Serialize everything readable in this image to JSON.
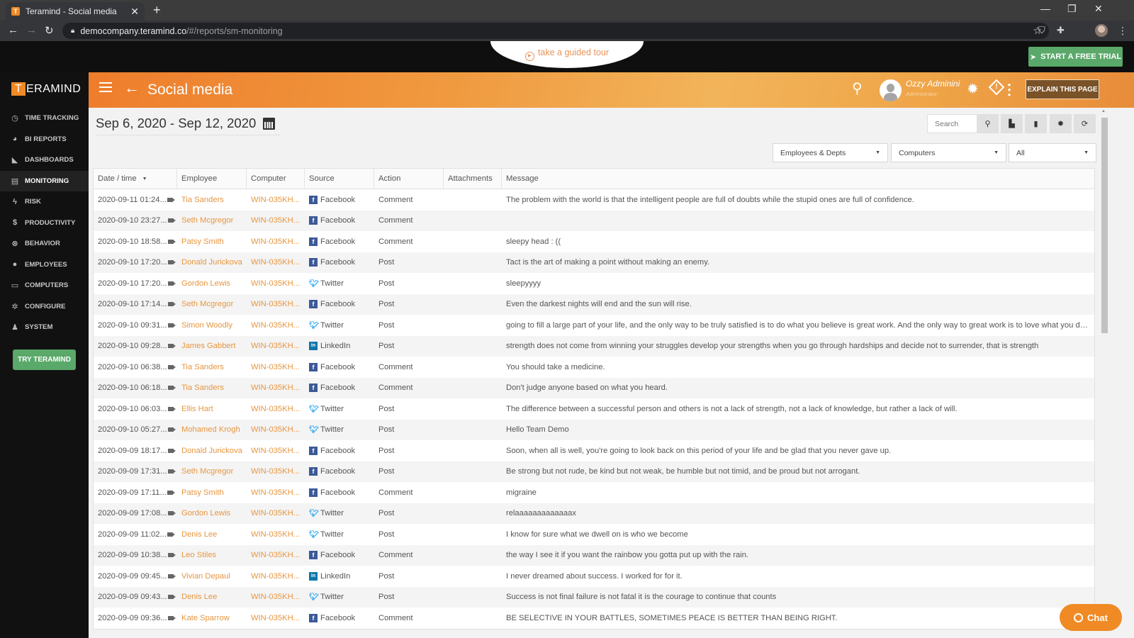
{
  "browser": {
    "tab_title": "Teramind - Social media",
    "favicon_letter": "T",
    "url_host": "democompany.teramind.co",
    "url_path": "/#/reports/sm-monitoring"
  },
  "topbar": {
    "tour_label": "take a guided tour",
    "trial_button": "START A FREE TRIAL"
  },
  "sidebar": {
    "logo_letter": "T",
    "logo_rest": "ERAMIND",
    "items": [
      {
        "label": "TIME TRACKING",
        "icon": "clock-icon",
        "glyph": "◷",
        "active": false
      },
      {
        "label": "BI REPORTS",
        "icon": "pie-chart-icon",
        "glyph": "◕",
        "active": false
      },
      {
        "label": "DASHBOARDS",
        "icon": "area-chart-icon",
        "glyph": "◣",
        "active": false
      },
      {
        "label": "MONITORING",
        "icon": "monitoring-icon",
        "glyph": "▤",
        "active": true
      },
      {
        "label": "RISK",
        "icon": "bolt-icon",
        "glyph": "ϟ",
        "active": false
      },
      {
        "label": "PRODUCTIVITY",
        "icon": "dollar-icon",
        "glyph": "$",
        "active": false
      },
      {
        "label": "BEHAVIOR",
        "icon": "gamepad-icon",
        "glyph": "⊗",
        "active": false
      },
      {
        "label": "EMPLOYEES",
        "icon": "users-icon",
        "glyph": "●",
        "active": false
      },
      {
        "label": "COMPUTERS",
        "icon": "desktop-icon",
        "glyph": "▭",
        "active": false
      },
      {
        "label": "CONFIGURE",
        "icon": "gear-icon",
        "glyph": "✲",
        "active": false
      },
      {
        "label": "SYSTEM",
        "icon": "user-search-icon",
        "glyph": "♟",
        "active": false
      }
    ],
    "try_button": "TRY TERAMIND"
  },
  "header": {
    "title": "Social media",
    "user_name": "Ozzy Adminini",
    "user_role": "Administrator",
    "explain_button": "EXPLAIN THIS PAGE"
  },
  "content": {
    "date_range": "Sep 6, 2020 - Sep 12, 2020",
    "search_placeholder": "Search",
    "filters": {
      "employees": "Employees & Depts",
      "computers": "Computers",
      "source": "All"
    }
  },
  "table": {
    "columns": [
      "Date / time",
      "Employee",
      "Computer",
      "Source",
      "Action",
      "Attachments",
      "Message"
    ],
    "rows": [
      {
        "date": "2020-09-11 01:24...",
        "employee": "Tia Sanders",
        "computer": "WIN-035KH...",
        "source": "Facebook",
        "action": "Comment",
        "attachments": "",
        "message": "The problem with the world is that the intelligent people are full of doubts while the stupid ones are full of confidence."
      },
      {
        "date": "2020-09-10 23:27...",
        "employee": "Seth Mcgregor",
        "computer": "WIN-035KH...",
        "source": "Facebook",
        "action": "Comment",
        "attachments": "",
        "message": ""
      },
      {
        "date": "2020-09-10 18:58...",
        "employee": "Patsy Smith",
        "computer": "WIN-035KH...",
        "source": "Facebook",
        "action": "Comment",
        "attachments": "",
        "message": "sleepy head : (("
      },
      {
        "date": "2020-09-10 17:20...",
        "employee": "Donald Jurickova",
        "computer": "WIN-035KH...",
        "source": "Facebook",
        "action": "Post",
        "attachments": "",
        "message": "Tact is the art of making a point without making an enemy."
      },
      {
        "date": "2020-09-10 17:20...",
        "employee": "Gordon Lewis",
        "computer": "WIN-035KH...",
        "source": "Twitter",
        "action": "Post",
        "attachments": "",
        "message": "sleepyyyy"
      },
      {
        "date": "2020-09-10 17:14...",
        "employee": "Seth Mcgregor",
        "computer": "WIN-035KH...",
        "source": "Facebook",
        "action": "Post",
        "attachments": "",
        "message": "Even the darkest nights will end and the sun will rise."
      },
      {
        "date": "2020-09-10 09:31...",
        "employee": "Simon Woodly",
        "computer": "WIN-035KH...",
        "source": "Twitter",
        "action": "Post",
        "attachments": "",
        "message": "going to fill a large part of your life, and the only way to be truly satisfied is to do what you believe is great work. And the only way to great work is to love what you do..."
      },
      {
        "date": "2020-09-10 09:28...",
        "employee": "James Gabbert",
        "computer": "WIN-035KH...",
        "source": "LinkedIn",
        "action": "Post",
        "attachments": "",
        "message": "strength does not come from winning your struggles develop your strengths when you go through hardships and decide not to surrender, that is strength"
      },
      {
        "date": "2020-09-10 06:38...",
        "employee": "Tia Sanders",
        "computer": "WIN-035KH...",
        "source": "Facebook",
        "action": "Comment",
        "attachments": "",
        "message": "You should take a medicine."
      },
      {
        "date": "2020-09-10 06:18...",
        "employee": "Tia Sanders",
        "computer": "WIN-035KH...",
        "source": "Facebook",
        "action": "Comment",
        "attachments": "",
        "message": "Don't judge anyone based on what you heard."
      },
      {
        "date": "2020-09-10 06:03...",
        "employee": "Ellis Hart",
        "computer": "WIN-035KH...",
        "source": "Twitter",
        "action": "Post",
        "attachments": "",
        "message": "The difference between a successful person and others is not a lack of strength, not a lack of knowledge, but rather a lack of will."
      },
      {
        "date": "2020-09-10 05:27...",
        "employee": "Mohamed Krogh",
        "computer": "WIN-035KH...",
        "source": "Twitter",
        "action": "Post",
        "attachments": "",
        "message": "Hello Team Demo"
      },
      {
        "date": "2020-09-09 18:17...",
        "employee": "Donald Jurickova",
        "computer": "WIN-035KH...",
        "source": "Facebook",
        "action": "Post",
        "attachments": "",
        "message": "Soon, when all is well, you're going to look back on this period of your life and be glad that you never gave up."
      },
      {
        "date": "2020-09-09 17:31...",
        "employee": "Seth Mcgregor",
        "computer": "WIN-035KH...",
        "source": "Facebook",
        "action": "Post",
        "attachments": "",
        "message": "Be strong but not rude, be kind but not weak, be humble but not timid, and be proud but not arrogant."
      },
      {
        "date": "2020-09-09 17:11...",
        "employee": "Patsy Smith",
        "computer": "WIN-035KH...",
        "source": "Facebook",
        "action": "Comment",
        "attachments": "",
        "message": "migraine"
      },
      {
        "date": "2020-09-09 17:08...",
        "employee": "Gordon Lewis",
        "computer": "WIN-035KH...",
        "source": "Twitter",
        "action": "Post",
        "attachments": "",
        "message": "relaaaaaaaaaaaaax"
      },
      {
        "date": "2020-09-09 11:02...",
        "employee": "Denis Lee",
        "computer": "WIN-035KH...",
        "source": "Twitter",
        "action": "Post",
        "attachments": "",
        "message": "I know for sure what we dwell on is who we become"
      },
      {
        "date": "2020-09-09 10:38...",
        "employee": "Leo Stiles",
        "computer": "WIN-035KH...",
        "source": "Facebook",
        "action": "Comment",
        "attachments": "",
        "message": "the way I see it if you want the rainbow you gotta put up with the rain."
      },
      {
        "date": "2020-09-09 09:45...",
        "employee": "Vivian Depaul",
        "computer": "WIN-035KH...",
        "source": "LinkedIn",
        "action": "Post",
        "attachments": "",
        "message": "I never dreamed about success. I worked for for it."
      },
      {
        "date": "2020-09-09 09:43...",
        "employee": "Denis Lee",
        "computer": "WIN-035KH...",
        "source": "Twitter",
        "action": "Post",
        "attachments": "",
        "message": "Success is not final failure is not fatal it is the courage to continue that counts"
      },
      {
        "date": "2020-09-09 09:36...",
        "employee": "Kate Sparrow",
        "computer": "WIN-035KH...",
        "source": "Facebook",
        "action": "Comment",
        "attachments": "",
        "message": "BE SELECTIVE IN YOUR BATTLES, SOMETIMES PEACE IS BETTER THAN BEING RIGHT."
      }
    ]
  },
  "chat": {
    "label": "Chat"
  },
  "colors": {
    "accent_orange": "#f08a24",
    "green_button": "#5aa86a",
    "link_orange": "#e7963f",
    "facebook": "#3b5998",
    "twitter": "#1da1f2",
    "linkedin": "#0e76a8"
  }
}
